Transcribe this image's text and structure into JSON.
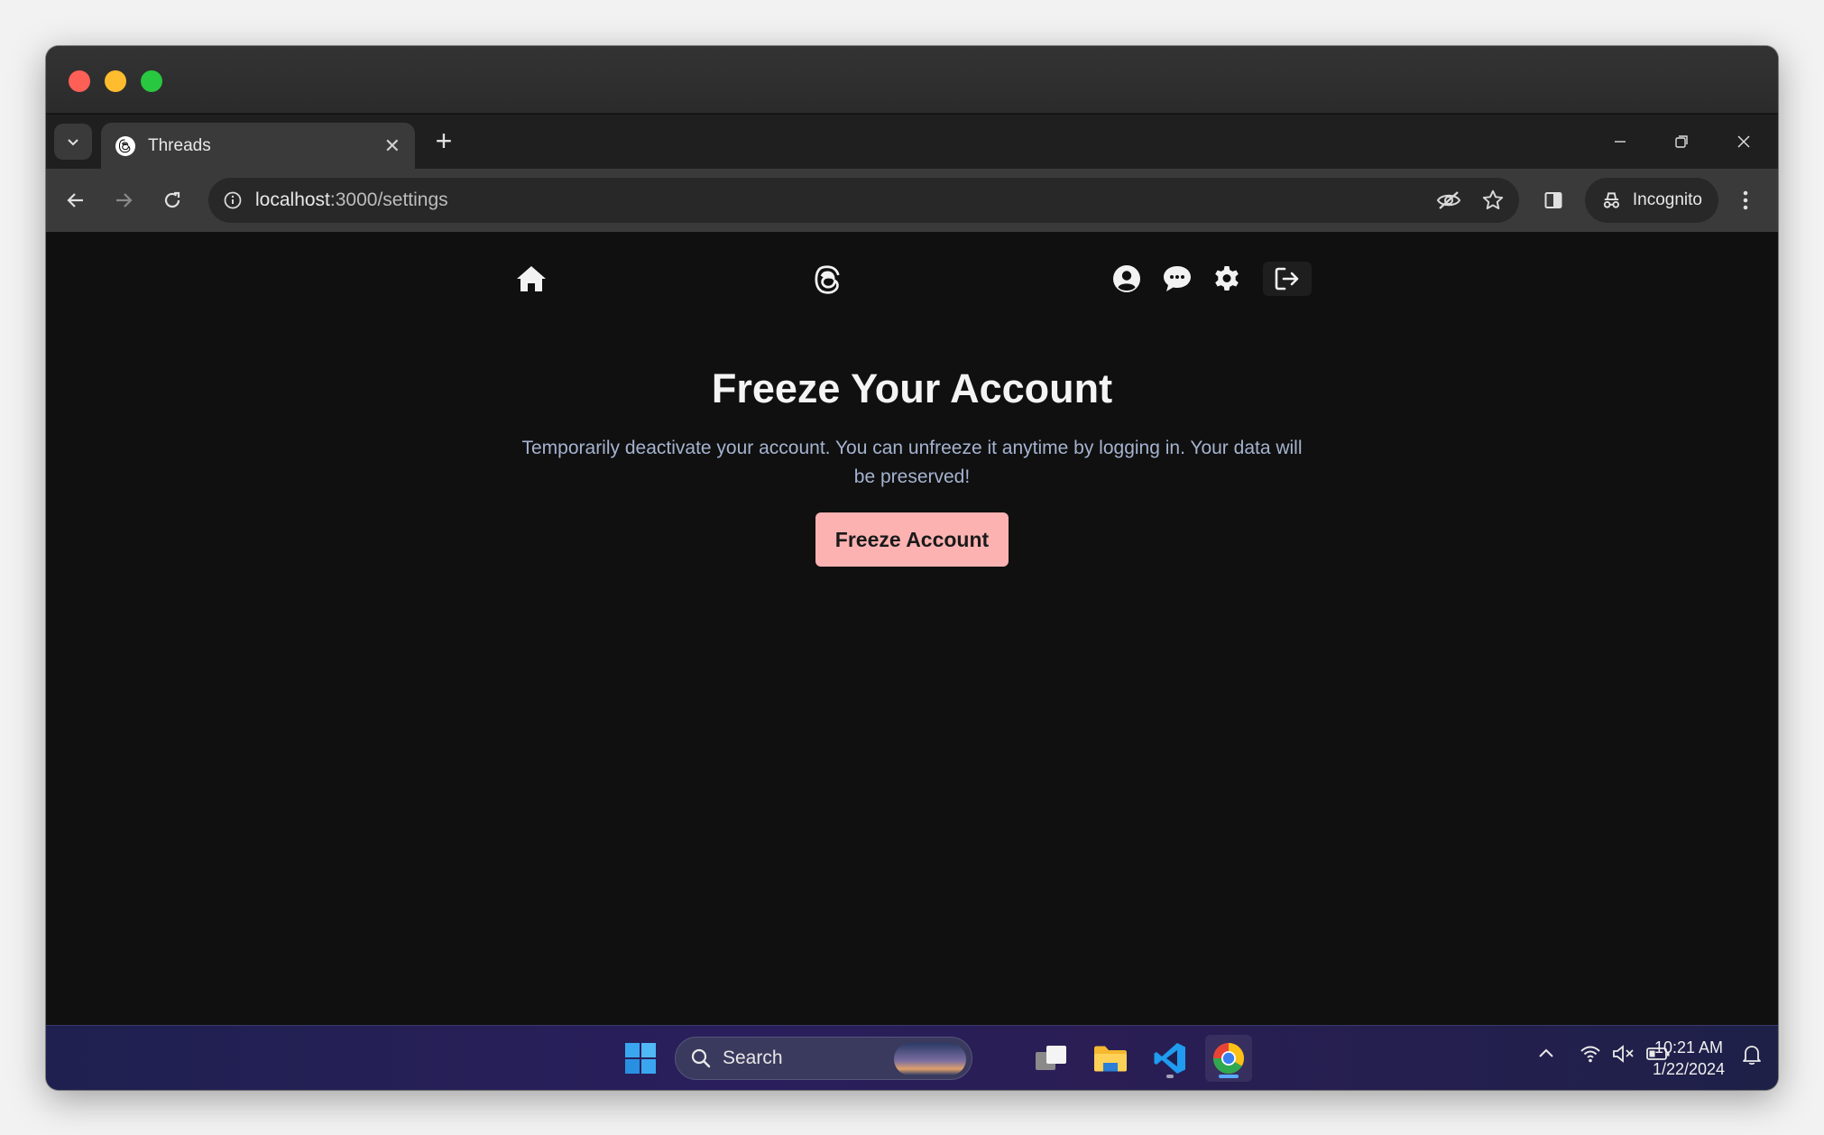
{
  "browser": {
    "tab": {
      "title": "Threads"
    },
    "address": {
      "host": "localhost",
      "path": ":3000/settings"
    },
    "profile_label": "Incognito"
  },
  "page": {
    "heading": "Freeze Your Account",
    "description": "Temporarily deactivate your account. You can unfreeze it anytime by logging in. Your data will be preserved!",
    "freeze_button": "Freeze Account"
  },
  "taskbar": {
    "search_label": "Search",
    "time": "10:21 AM",
    "date": "1/22/2024"
  },
  "colors": {
    "page_background": "#101010",
    "button_accent": "#fdb2b2",
    "description_text": "#a5b3cf"
  }
}
